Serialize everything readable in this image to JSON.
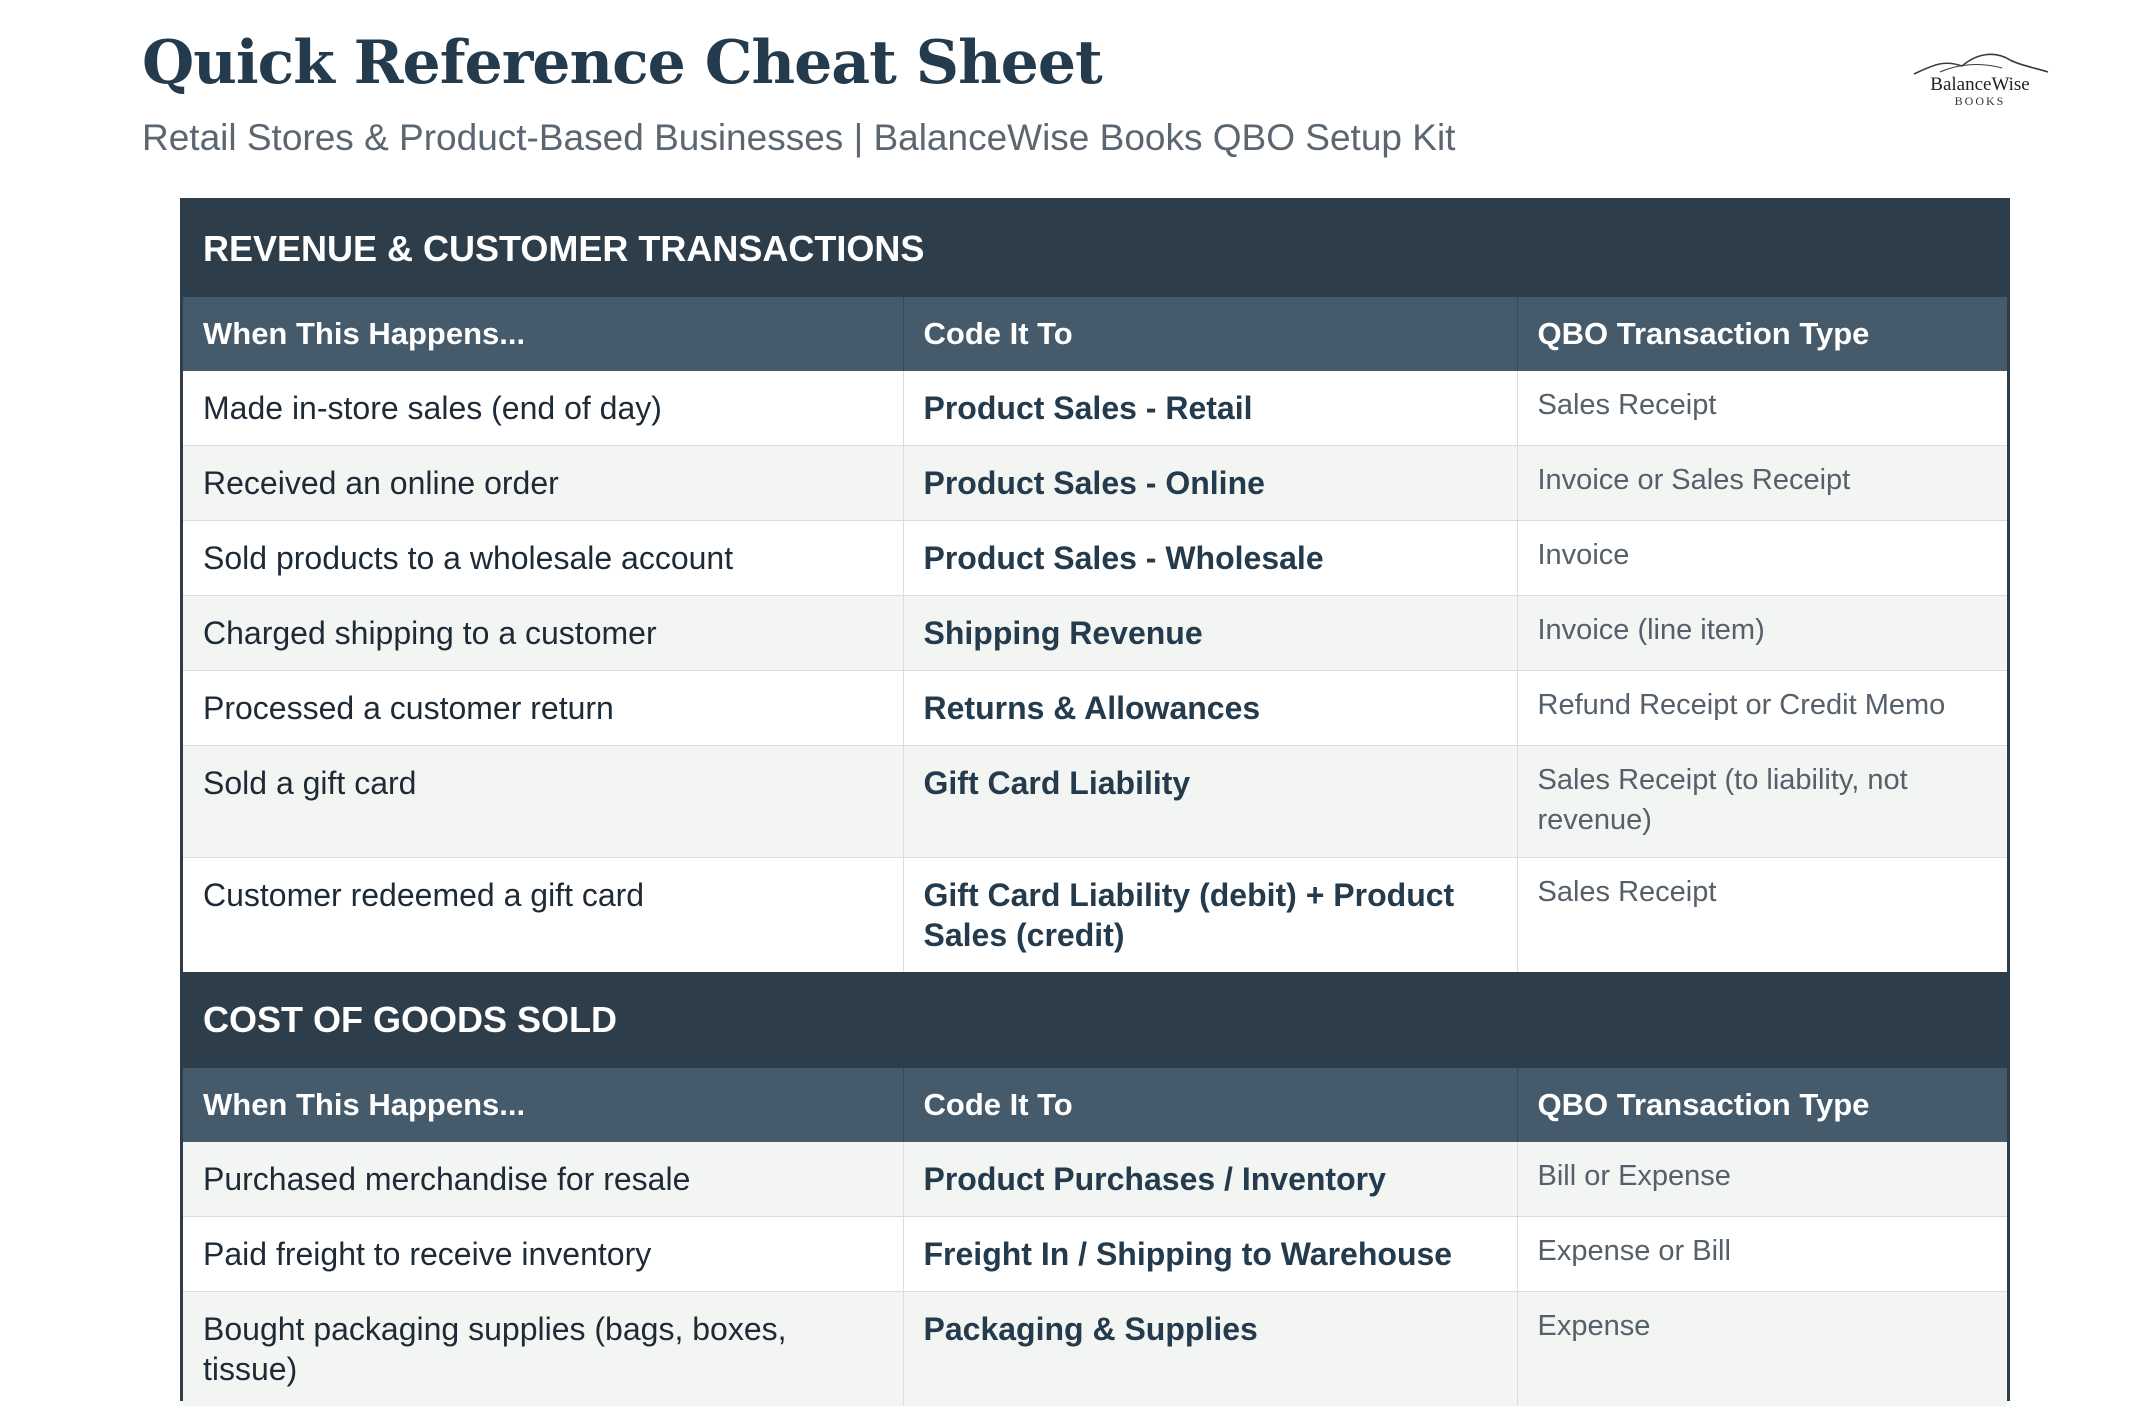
{
  "header": {
    "title": "Quick Reference Cheat Sheet",
    "subtitle": "Retail Stores & Product-Based Businesses | BalanceWise Books QBO Setup Kit"
  },
  "logo": {
    "name": "BalanceWise",
    "sub": "BOOKS"
  },
  "columns": [
    "When This Happens...",
    "Code It To",
    "QBO Transaction Type"
  ],
  "sections": [
    {
      "title": "REVENUE & CUSTOMER TRANSACTIONS",
      "rows": [
        {
          "event": "Made in-store sales (end of day)",
          "account": "Product Sales - Retail",
          "type": "Sales Receipt"
        },
        {
          "event": "Received an online order",
          "account": "Product Sales - Online",
          "type": "Invoice or Sales Receipt"
        },
        {
          "event": "Sold products to a wholesale account",
          "account": "Product Sales - Wholesale",
          "type": "Invoice"
        },
        {
          "event": "Charged shipping to a customer",
          "account": "Shipping Revenue",
          "type": "Invoice (line item)"
        },
        {
          "event": "Processed a customer return",
          "account": "Returns & Allowances",
          "type": "Refund Receipt or Credit Memo"
        },
        {
          "event": "Sold a gift card",
          "account": "Gift Card Liability",
          "type": "Sales Receipt (to liability, not revenue)"
        },
        {
          "event": "Customer redeemed a gift card",
          "account": "Gift Card Liability (debit) + Product Sales (credit)",
          "type": "Sales Receipt"
        }
      ]
    },
    {
      "title": "COST OF GOODS SOLD",
      "rows": [
        {
          "event": "Purchased merchandise for resale",
          "account": "Product Purchases / Inventory",
          "type": "Bill or Expense"
        },
        {
          "event": "Paid freight to receive inventory",
          "account": "Freight In / Shipping to Warehouse",
          "type": "Expense or Bill"
        },
        {
          "event": "Bought packaging supplies (bags, boxes, tissue)",
          "account": "Packaging & Supplies",
          "type": "Expense"
        }
      ]
    }
  ]
}
